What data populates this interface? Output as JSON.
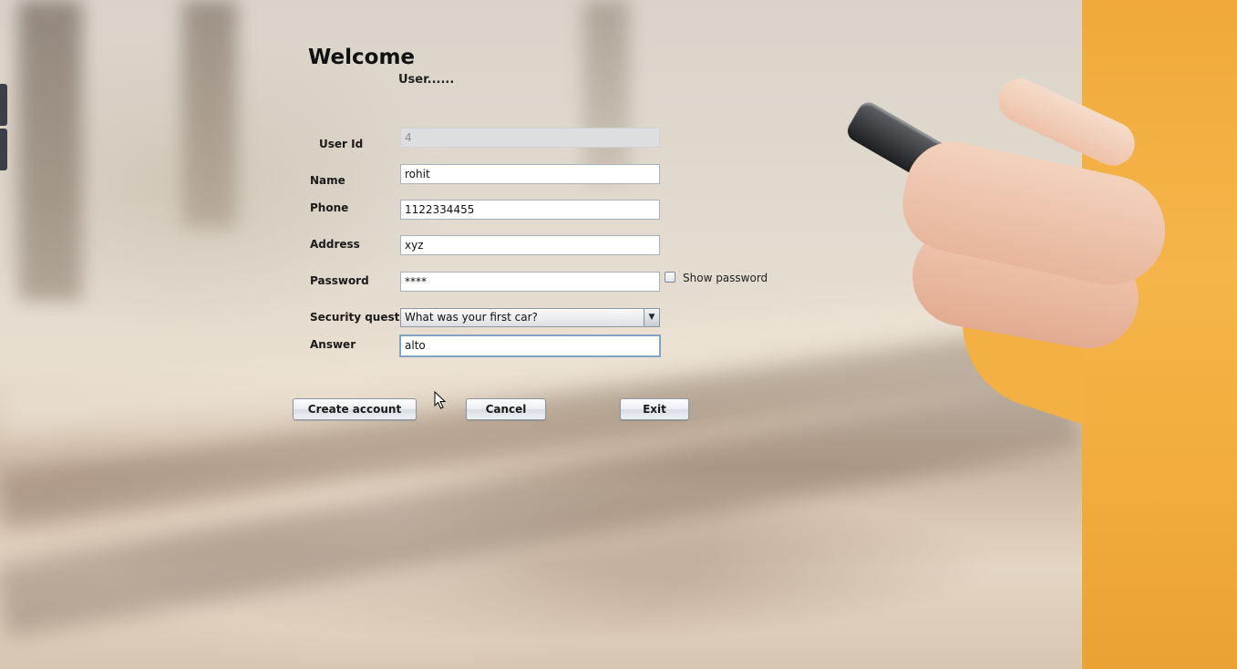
{
  "header": {
    "title": "Welcome",
    "subtitle": "User......"
  },
  "form": {
    "user_id": {
      "label": "User Id",
      "value": "4"
    },
    "name": {
      "label": "Name",
      "value": "rohit"
    },
    "phone": {
      "label": "Phone",
      "value": "1122334455"
    },
    "address": {
      "label": "Address",
      "value": "xyz"
    },
    "password": {
      "label": "Password",
      "value": "****"
    },
    "show_password_label": "Show password",
    "security_question": {
      "label": "Security question",
      "selected": "What was your first car?"
    },
    "answer": {
      "label": "Answer",
      "value": "alto"
    }
  },
  "buttons": {
    "create": "Create account",
    "cancel": "Cancel",
    "exit": "Exit"
  },
  "icons": {
    "dropdown": "chevron-down-icon",
    "cursor": "mouse-pointer-icon"
  },
  "colors": {
    "sweater": "#f3b144",
    "field_border": "#a7b0bd",
    "focus_border": "#7fa4c8"
  }
}
